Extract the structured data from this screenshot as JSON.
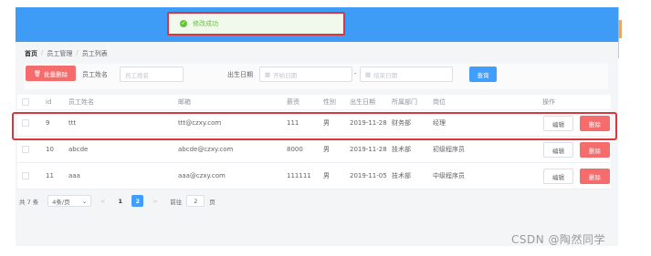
{
  "toast": {
    "message": "修改成功",
    "icon": "check-circle-icon"
  },
  "breadcrumb": {
    "home": "首页",
    "sep": "/",
    "level1": "员工管理",
    "level2": "员工列表"
  },
  "search": {
    "batch_delete_label": "批量删除",
    "name_label": "员工姓名",
    "name_placeholder": "员工姓名",
    "birth_label": "出生日期",
    "start_placeholder": "开始日期",
    "range_sep": "-",
    "end_placeholder": "结束日期",
    "query_label": "查询"
  },
  "table": {
    "columns": [
      "id",
      "员工姓名",
      "邮箱",
      "薪资",
      "性别",
      "出生日期",
      "所属部门",
      "岗位",
      "操作"
    ],
    "rows": [
      {
        "id": "9",
        "name": "ttt",
        "email": "ttt@czxy.com",
        "salary": "111",
        "gender": "男",
        "birth": "2019-11-28",
        "dept": "财务部",
        "post": "经理"
      },
      {
        "id": "10",
        "name": "abcde",
        "email": "abcde@czxy.com",
        "salary": "8000",
        "gender": "男",
        "birth": "2019-11-28",
        "dept": "技术部",
        "post": "初级程序员"
      },
      {
        "id": "11",
        "name": "aaa",
        "email": "aaa@czxy.com",
        "salary": "111111",
        "gender": "男",
        "birth": "2019-11-05",
        "dept": "技术部",
        "post": "中级程序员"
      }
    ],
    "edit_label": "编辑",
    "delete_label": "删除"
  },
  "pager": {
    "total": "共 7 条",
    "page_size": "4条/页",
    "prev": "<",
    "pages": [
      "1",
      "2"
    ],
    "current": "2",
    "next": ">",
    "goto_label": "前往",
    "goto_value": "2",
    "page_unit": "页"
  },
  "watermark": "CSDN @陶然同学",
  "colors": {
    "primary": "#409eff",
    "danger": "#f56c6c",
    "success": "#67c23a",
    "highlight": "#d9363e"
  }
}
